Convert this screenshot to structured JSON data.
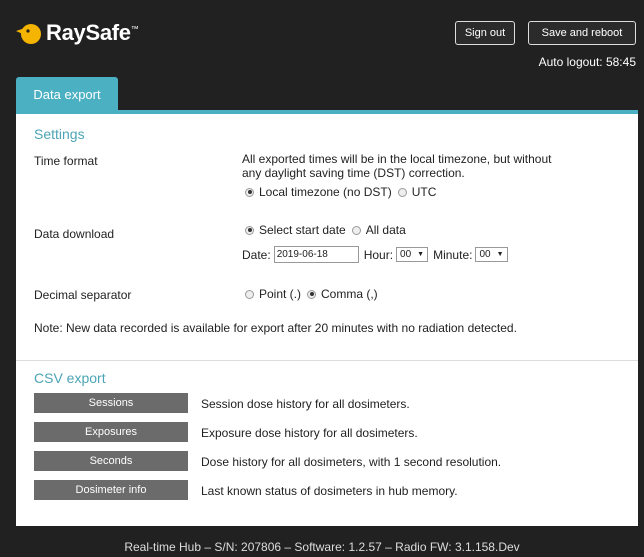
{
  "header": {
    "brand": "RaySafe",
    "brand_tm": "™",
    "signout_label": "Sign out",
    "save_reboot_label": "Save and reboot",
    "auto_logout": "Auto logout: 58:45"
  },
  "tab": {
    "label": "Data export"
  },
  "settings": {
    "title": "Settings",
    "time_format": {
      "label": "Time format",
      "desc_line1": "All exported times will be in the local timezone, but without",
      "desc_line2": "any daylight saving time (DST) correction.",
      "option_local": "Local timezone (no DST)",
      "option_utc": "UTC",
      "selected": "local"
    },
    "data_download": {
      "label": "Data download",
      "option_start": "Select start date",
      "option_all": "All data",
      "selected": "start",
      "date_label": "Date:",
      "date_value": "2019-06-18",
      "hour_label": "Hour:",
      "hour_value": "00",
      "minute_label": "Minute:",
      "minute_value": "00"
    },
    "decimal": {
      "label": "Decimal separator",
      "option_point": "Point (.)",
      "option_comma": "Comma (,)",
      "selected": "comma"
    },
    "note": "Note: New data recorded is available for export after 20 minutes with no radiation detected."
  },
  "csv": {
    "title": "CSV export",
    "items": [
      {
        "button": "Sessions",
        "desc": "Session dose history for all dosimeters."
      },
      {
        "button": "Exposures",
        "desc": "Exposure dose history for all dosimeters."
      },
      {
        "button": "Seconds",
        "desc": "Dose history for all dosimeters, with 1 second resolution."
      },
      {
        "button": "Dosimeter info",
        "desc": "Last known status of dosimeters in hub memory."
      }
    ]
  },
  "footer": "Real-time Hub – S/N: 207806 – Software: 1.2.57 – Radio FW: 3.1.158.Dev",
  "colors": {
    "accent": "#4cb0c3",
    "background": "#212121",
    "button_gray": "#6b6b6b",
    "logo_yellow": "#f5b400"
  },
  "icons": {
    "logo": "raysafe-bird-icon",
    "dropdown": "chevron-down-icon"
  }
}
